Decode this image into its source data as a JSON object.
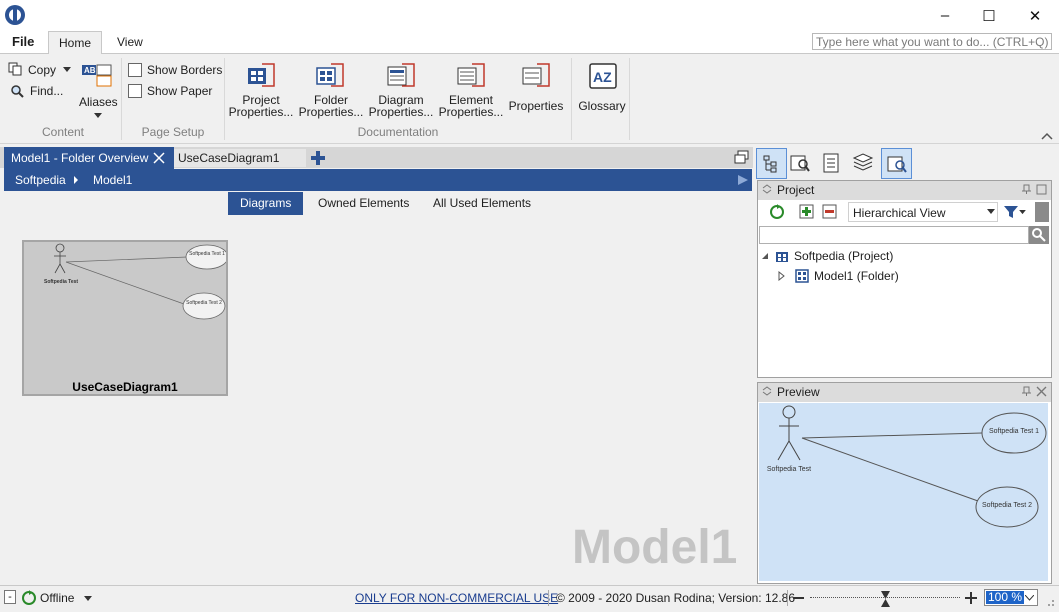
{
  "ribbon_tabs": {
    "file": "File",
    "home": "Home",
    "view": "View"
  },
  "search": {
    "placeholder": "Type here what you want to do...  (CTRL+Q)"
  },
  "window_controls": {
    "minimize": "–",
    "maximize": "☐",
    "close": "✕"
  },
  "content_group": {
    "copy": "Copy",
    "find": "Find...",
    "aliases": "Aliases",
    "label": "Content"
  },
  "page_setup_group": {
    "show_borders": "Show Borders",
    "show_paper": "Show Paper",
    "label": "Page Setup"
  },
  "documentation_group": {
    "label": "Documentation",
    "project_properties": [
      "Project",
      "Properties..."
    ],
    "folder_properties": [
      "Folder",
      "Properties..."
    ],
    "diagram_properties": [
      "Diagram",
      "Properties..."
    ],
    "element_properties": [
      "Element",
      "Properties..."
    ],
    "properties": "Properties"
  },
  "glossary": "Glossary",
  "doc_tabs": {
    "active": "Model1 - Folder Overview",
    "second": "UseCaseDiagram1"
  },
  "breadcrumb": {
    "root": "Softpedia",
    "current": "Model1"
  },
  "sub_tabs": {
    "diagrams": "Diagrams",
    "owned": "Owned Elements",
    "all_used": "All Used Elements"
  },
  "thumbnail": {
    "title": "UseCaseDiagram1",
    "actor_label": "Softpedia Test",
    "usecase1": "Softpedia Test 1",
    "usecase2": "Softpedia Test 2"
  },
  "watermark": "Model1",
  "project_panel": {
    "title": "Project",
    "view_select": "Hierarchical View",
    "tree": {
      "root": "Softpedia (Project)",
      "child": "Model1 (Folder)"
    }
  },
  "preview_panel": {
    "title": "Preview",
    "actor_label": "Softpedia Test",
    "usecase1": "Softpedia Test 1",
    "usecase2": "Softpedia Test 2"
  },
  "status": {
    "offline": "Offline",
    "license_link": "ONLY FOR NON-COMMERCIAL USE",
    "copyright": "© 2009 - 2020 Dusan Rodina; Version: 12.86",
    "zoom": "100 %"
  },
  "colors": {
    "accent": "#2c5394",
    "preview_bg": "#cfe2f6"
  }
}
